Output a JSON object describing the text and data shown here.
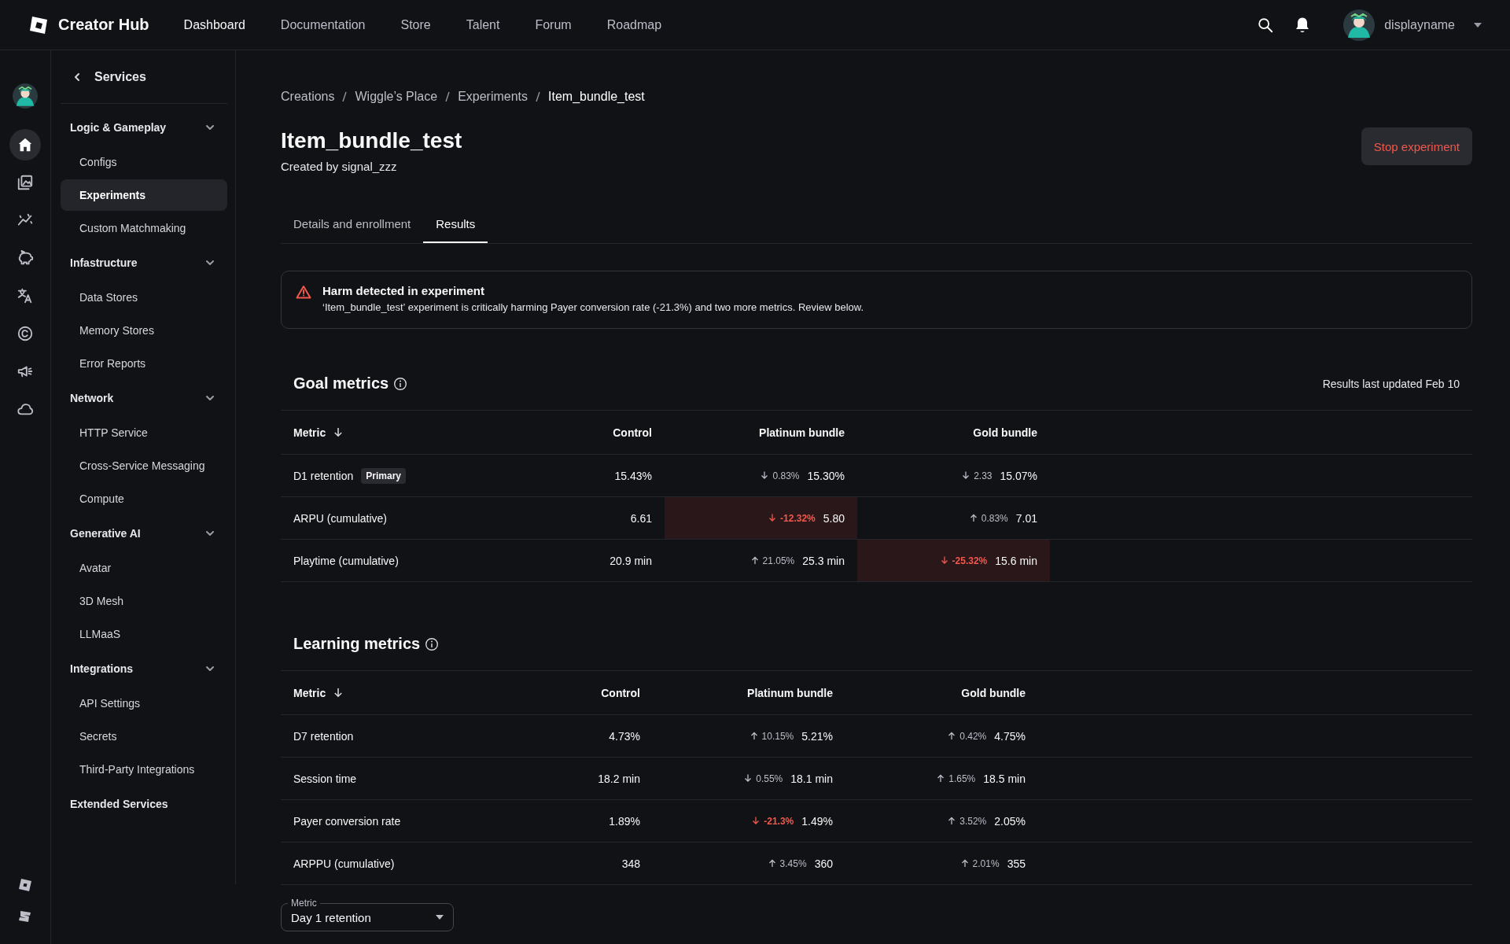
{
  "topbar": {
    "logo_text": "Creator Hub",
    "nav": [
      {
        "label": "Dashboard",
        "selected": true
      },
      {
        "label": "Documentation",
        "selected": false
      },
      {
        "label": "Store",
        "selected": false
      },
      {
        "label": "Talent",
        "selected": false
      },
      {
        "label": "Forum",
        "selected": false
      },
      {
        "label": "Roadmap",
        "selected": false
      }
    ],
    "username": "displayname"
  },
  "rail": {
    "items": [
      {
        "kind": "home",
        "selected": true
      },
      {
        "kind": "gallery",
        "selected": false
      },
      {
        "kind": "analytics",
        "selected": false
      },
      {
        "kind": "piggy",
        "selected": false
      },
      {
        "kind": "translate",
        "selected": false
      },
      {
        "kind": "copyright",
        "selected": false
      },
      {
        "kind": "megaphone",
        "selected": false
      },
      {
        "kind": "cloud",
        "selected": false
      }
    ],
    "footer": [
      {
        "kind": "square"
      },
      {
        "kind": "mark"
      }
    ]
  },
  "sidebar": {
    "title": "Services",
    "sections": [
      {
        "kind": "group",
        "label": "Logic & Gameplay",
        "expanded": true,
        "items": [
          {
            "label": "Configs",
            "selected": false
          },
          {
            "label": "Experiments",
            "selected": true
          },
          {
            "label": "Custom Matchmaking",
            "selected": false
          }
        ]
      },
      {
        "kind": "group",
        "label": "Infastructure",
        "expanded": true,
        "items": [
          {
            "label": "Data Stores",
            "selected": false
          },
          {
            "label": "Memory Stores",
            "selected": false
          },
          {
            "label": "Error Reports",
            "selected": false
          }
        ]
      },
      {
        "kind": "group",
        "label": "Network",
        "expanded": true,
        "items": [
          {
            "label": "HTTP Service",
            "selected": false
          },
          {
            "label": "Cross-Service Messaging",
            "selected": false
          },
          {
            "label": "Compute",
            "selected": false
          }
        ]
      },
      {
        "kind": "group",
        "label": "Generative AI",
        "expanded": true,
        "items": [
          {
            "label": "Avatar",
            "selected": false
          },
          {
            "label": "3D Mesh",
            "selected": false
          },
          {
            "label": "LLMaaS",
            "selected": false
          }
        ]
      },
      {
        "kind": "group",
        "label": "Integrations",
        "expanded": true,
        "items": [
          {
            "label": "API Settings",
            "selected": false
          },
          {
            "label": "Secrets",
            "selected": false
          },
          {
            "label": "Third-Party Integrations",
            "selected": false
          }
        ]
      },
      {
        "kind": "link",
        "label": "Extended Services"
      }
    ]
  },
  "breadcrumb": [
    "Creations",
    "Wiggle’s Place",
    "Experiments",
    "Item_bundle_test"
  ],
  "header": {
    "title": "Item_bundle_test",
    "subtitle": "Created by signal_zzz",
    "action": "Stop experiment"
  },
  "tabs": [
    {
      "label": "Details and enrollment",
      "selected": false
    },
    {
      "label": "Results",
      "selected": true
    }
  ],
  "alert": {
    "title": "Harm detected in experiment",
    "message": "‘Item_bundle_test’ experiment is critically harming Payer conversion rate (-21.3%) and two more metrics. Review below."
  },
  "goal_metrics": {
    "title": "Goal metrics",
    "updated": "Results last updated Feb 10",
    "table": {
      "columns": [
        {
          "label": "Metric",
          "sorted": true
        },
        {
          "label": "Control",
          "sorted": false
        },
        {
          "label": "Platinum bundle",
          "sorted": false
        },
        {
          "label": "Gold bundle",
          "sorted": false
        }
      ],
      "rows": [
        {
          "metric": "D1 retention",
          "badge": "Primary",
          "control": "15.43%",
          "variants": [
            {
              "kind": "down",
              "delta": "0.83%",
              "value": "15.30%",
              "harm": false,
              "highlighted": false
            },
            {
              "kind": "down",
              "delta": "2.33",
              "value": "15.07%",
              "harm": false,
              "highlighted": false
            }
          ]
        },
        {
          "metric": "ARPU (cumulative)",
          "control": "6.61",
          "variants": [
            {
              "kind": "down",
              "delta": "-12.32%",
              "value": "5.80",
              "harm": true,
              "highlighted": true
            },
            {
              "kind": "up",
              "delta": "0.83%",
              "value": "7.01",
              "harm": false,
              "highlighted": false
            }
          ]
        },
        {
          "metric": "Playtime (cumulative)",
          "control": "20.9 min",
          "variants": [
            {
              "kind": "up",
              "delta": "21.05%",
              "value": "25.3 min",
              "harm": false,
              "highlighted": false
            },
            {
              "kind": "down",
              "delta": "-25.32%",
              "value": "15.6 min",
              "harm": true,
              "highlighted": true
            }
          ]
        }
      ]
    }
  },
  "learning_metrics": {
    "title": "Learning metrics",
    "table": {
      "columns": [
        {
          "label": "Metric",
          "sorted": true
        },
        {
          "label": "Control",
          "sorted": false
        },
        {
          "label": "Platinum bundle",
          "sorted": false
        },
        {
          "label": "Gold bundle",
          "sorted": false
        }
      ],
      "rows": [
        {
          "metric": "D7 retention",
          "control": "4.73%",
          "variants": [
            {
              "kind": "up",
              "delta": "10.15%",
              "value": "5.21%",
              "harm": false,
              "highlighted": false
            },
            {
              "kind": "up",
              "delta": "0.42%",
              "value": "4.75%",
              "harm": false,
              "highlighted": false
            }
          ]
        },
        {
          "metric": "Session time",
          "control": "18.2 min",
          "variants": [
            {
              "kind": "down",
              "delta": "0.55%",
              "value": "18.1 min",
              "harm": false,
              "highlighted": false
            },
            {
              "kind": "up",
              "delta": "1.65%",
              "value": "18.5 min",
              "harm": false,
              "highlighted": false
            }
          ]
        },
        {
          "metric": "Payer conversion rate",
          "control": "1.89%",
          "variants": [
            {
              "kind": "down",
              "delta": "-21.3%",
              "value": "1.49%",
              "harm": true,
              "highlighted": false
            },
            {
              "kind": "up",
              "delta": "3.52%",
              "value": "2.05%",
              "harm": false,
              "highlighted": false
            }
          ]
        },
        {
          "metric": "ARPPU (cumulative)",
          "control": "348",
          "variants": [
            {
              "kind": "up",
              "delta": "3.45%",
              "value": "360",
              "harm": false,
              "highlighted": false
            },
            {
              "kind": "up",
              "delta": "2.01%",
              "value": "355",
              "harm": false,
              "highlighted": false
            }
          ]
        }
      ]
    }
  },
  "metric_select": {
    "label": "Metric",
    "value": "Day 1 retention"
  }
}
